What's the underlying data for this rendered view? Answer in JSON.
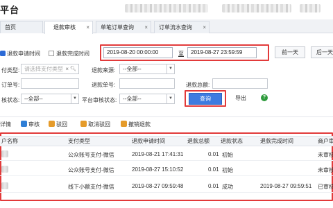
{
  "app": {
    "title": "平台"
  },
  "tabs": [
    {
      "label": "首页",
      "closable": false
    },
    {
      "label": "退款审核",
      "closable": true,
      "active": true
    },
    {
      "label": "单笔订单查询",
      "closable": true
    },
    {
      "label": "订单流水查询",
      "closable": true
    }
  ],
  "close_glyph": "×",
  "filters": {
    "time_type_apply": "退款申请时间",
    "time_type_done": "退款完成时间",
    "start_time": "2019-08-20  00:00:00",
    "to_label": "至",
    "end_time": "2019-08-27  23:59:59",
    "prev_day": "前一天",
    "next_day": "后一天",
    "pay_type_label": "付类型:",
    "pay_type_placeholder": "请选择支付类型",
    "refund_source_label": "退款来源:",
    "refund_source_value": "--全部--",
    "order_no_label": "订单号:",
    "refund_no_label": "退款单号:",
    "refund_total_label": "退款总额:",
    "audit_status_label": "核状态:",
    "audit_status_value": "--全部--",
    "platform_audit_label": "平台审核状态:",
    "platform_audit_value": "--全部--",
    "query_button": "查询",
    "export_button": "导出",
    "help_glyph": "?",
    "select_arrow": "▼"
  },
  "toolbar": {
    "detail": "详情",
    "audit": "审核",
    "reject": "驳回",
    "cancel_reject": "取消驳回",
    "revoke_refund": "撤销退款"
  },
  "table": {
    "headers": [
      "户名称",
      "支付类型",
      "退款申请时间",
      "退款总额",
      "退款状态",
      "退款完成时间",
      "商户审"
    ],
    "rows": [
      {
        "pay_type": "公众账号支付-微信",
        "apply_time": "2019-08-21 17:41:31",
        "amount": "0.01",
        "status": "初始",
        "done_time": "",
        "merchant_audit": "未审核"
      },
      {
        "pay_type": "公众账号支付-微信",
        "apply_time": "2019-08-27 15:10:52",
        "amount": "0.01",
        "status": "初始",
        "done_time": "",
        "merchant_audit": "未审核"
      },
      {
        "pay_type": "线下小额支付-微信",
        "apply_time": "2019-08-27 09:59:48",
        "amount": "0.01",
        "status": "成功",
        "done_time": "2019-08-27 09:59:51",
        "merchant_audit": "已审核"
      }
    ]
  },
  "colors": {
    "accent": "#3d7be0",
    "highlight_box": "#e23a3a",
    "help_green": "#2e9b3c"
  }
}
